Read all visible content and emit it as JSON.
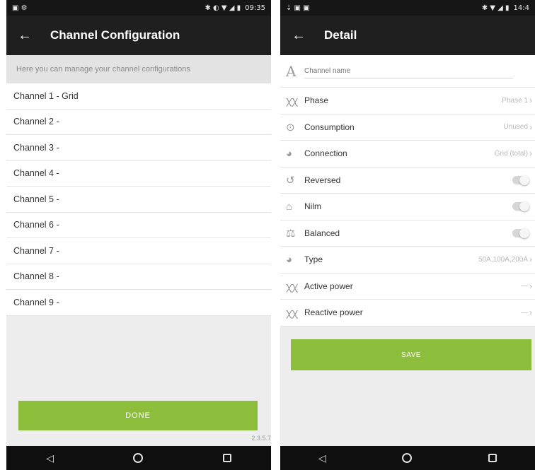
{
  "left": {
    "status": {
      "icons_left": "▣ ⚙",
      "icons_right": "✱ ◐ ▼ ◢ ▮",
      "time": "09:35"
    },
    "title": "Channel Configuration",
    "info": "Here you can manage your channel configurations",
    "channels": [
      "Channel 1 - Grid",
      "Channel 2 -",
      "Channel 3 -",
      "Channel 4 -",
      "Channel 5 -",
      "Channel 6 -",
      "Channel 7 -",
      "Channel 8 -",
      "Channel 9 -"
    ],
    "done_label": "DONE",
    "version": "2.3.5.7"
  },
  "right": {
    "status": {
      "icons_left": "⇣ ▣ ▣",
      "icons_right": "✱ ▼ ◢ ▮",
      "time": "14:4"
    },
    "title": "Detail",
    "name_placeholder": "Channel name",
    "rows": [
      {
        "icon": "phase-icon",
        "glyph": "ꭓꭓ",
        "label": "Phase",
        "value": "Phase 1",
        "kind": "select"
      },
      {
        "icon": "target-icon",
        "glyph": "⊙",
        "label": "Consumption",
        "value": "Unused",
        "kind": "select"
      },
      {
        "icon": "clamp-icon",
        "glyph": "◕",
        "label": "Connection",
        "value": "Grid (total)",
        "kind": "select"
      },
      {
        "icon": "reverse-arrow-icon",
        "glyph": "↺",
        "label": "Reversed",
        "kind": "toggle",
        "state": "off"
      },
      {
        "icon": "nilm-icon",
        "glyph": "⌂",
        "label": "Nilm",
        "kind": "toggle",
        "state": "off"
      },
      {
        "icon": "balance-icon",
        "glyph": "⚖",
        "label": "Balanced",
        "kind": "toggle",
        "state": "off"
      },
      {
        "icon": "clamp-icon",
        "glyph": "◕",
        "label": "Type",
        "value": "50A,100A,200A",
        "kind": "select"
      },
      {
        "icon": "phase-icon",
        "glyph": "ꭓꭓ",
        "label": "Active power",
        "value": "—",
        "kind": "select"
      },
      {
        "icon": "phase-icon",
        "glyph": "ꭓꭓ",
        "label": "Reactive power",
        "value": "—",
        "kind": "select"
      }
    ],
    "save_label": "SAVE"
  },
  "colors": {
    "accent": "#8dbe3b",
    "toolbar": "#1f1f1f",
    "statusbar": "#161616",
    "navbar": "#0f0f0f"
  }
}
